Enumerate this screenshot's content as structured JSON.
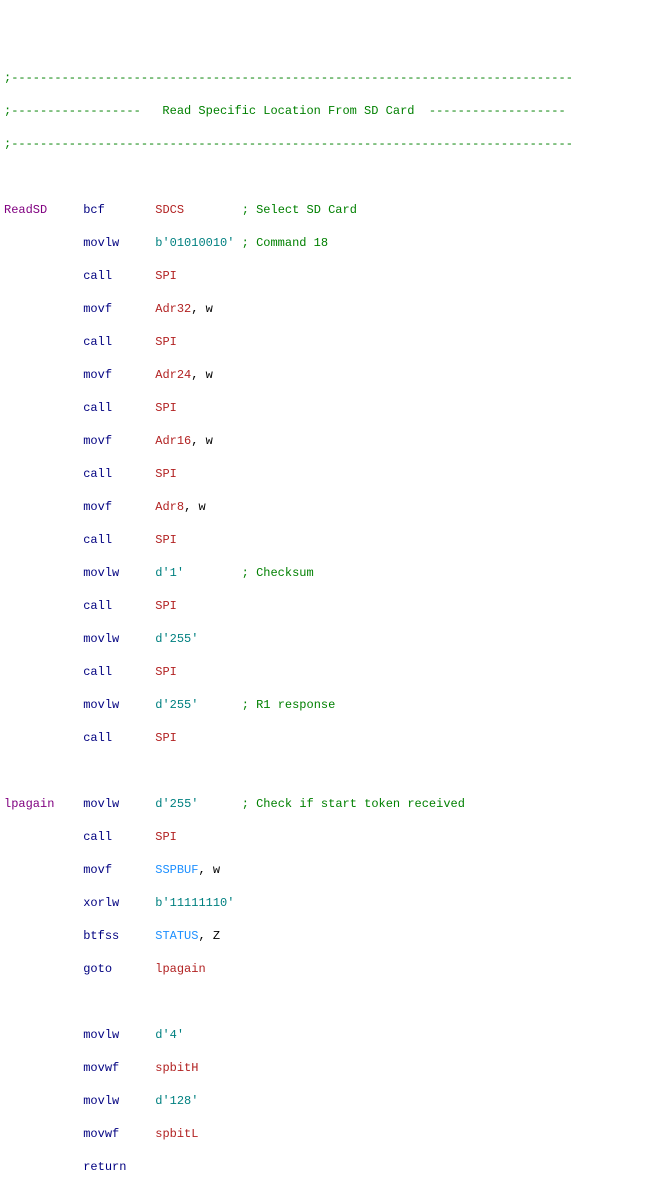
{
  "header": {
    "dash_top": ";------------------------------------------------------------------------------",
    "title_line": ";------------------   Read Specific Location From SD Card  -------------------",
    "dash_bottom": ";------------------------------------------------------------------------------"
  },
  "tok": {
    "labels": {
      "ReadSD": "ReadSD",
      "lpagain": "lpagain"
    },
    "mn": {
      "bcf": "bcf",
      "movlw": "movlw",
      "call": "call",
      "movf": "movf",
      "movwf": "movwf",
      "xorlw": "xorlw",
      "btfss": "btfss",
      "goto": "goto",
      "return": "return"
    },
    "id": {
      "SDCS": "SDCS",
      "SPI": "SPI",
      "Adr32": "Adr32",
      "Adr24": "Adr24",
      "Adr16": "Adr16",
      "Adr8": "Adr8",
      "lpagain": "lpagain",
      "spbitH": "spbitH",
      "spbitL": "spbitL"
    },
    "sfr": {
      "SSPBUF": "SSPBUF",
      "STATUS": "STATUS"
    },
    "pln": {
      "w": "w",
      "Z": "Z",
      "comma": ", "
    },
    "lit": {
      "b01010010": "b'01010010'",
      "d1": "d'1'",
      "d255": "d'255'",
      "b11111110": "b'11111110'",
      "d4": "d'4'",
      "d128": "d'128'"
    },
    "cmt": {
      "select": "; Select SD Card",
      "cmd18": "; Command 18",
      "cksum": "; Checksum",
      "r1": "; R1 response",
      "starttok": "; Check if start token received"
    }
  }
}
